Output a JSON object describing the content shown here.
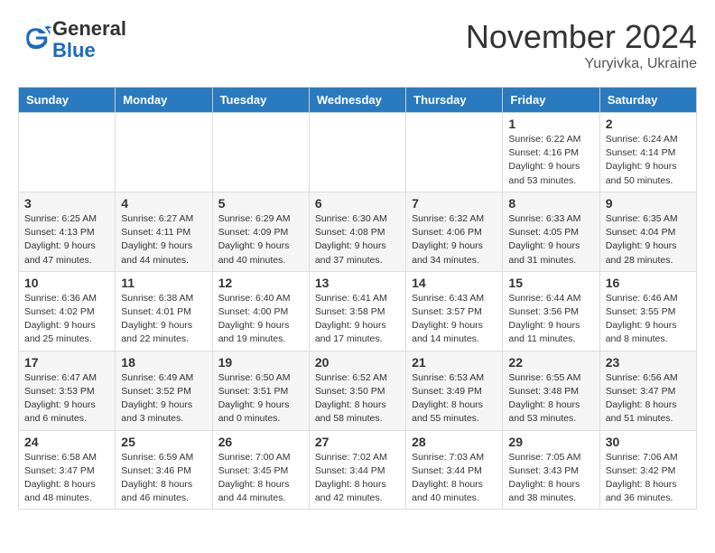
{
  "header": {
    "logo_general": "General",
    "logo_blue": "Blue",
    "month_title": "November 2024",
    "location": "Yuryivka, Ukraine"
  },
  "days_of_week": [
    "Sunday",
    "Monday",
    "Tuesday",
    "Wednesday",
    "Thursday",
    "Friday",
    "Saturday"
  ],
  "weeks": [
    [
      {
        "day": "",
        "info": ""
      },
      {
        "day": "",
        "info": ""
      },
      {
        "day": "",
        "info": ""
      },
      {
        "day": "",
        "info": ""
      },
      {
        "day": "",
        "info": ""
      },
      {
        "day": "1",
        "info": "Sunrise: 6:22 AM\nSunset: 4:16 PM\nDaylight: 9 hours and 53 minutes."
      },
      {
        "day": "2",
        "info": "Sunrise: 6:24 AM\nSunset: 4:14 PM\nDaylight: 9 hours and 50 minutes."
      }
    ],
    [
      {
        "day": "3",
        "info": "Sunrise: 6:25 AM\nSunset: 4:13 PM\nDaylight: 9 hours and 47 minutes."
      },
      {
        "day": "4",
        "info": "Sunrise: 6:27 AM\nSunset: 4:11 PM\nDaylight: 9 hours and 44 minutes."
      },
      {
        "day": "5",
        "info": "Sunrise: 6:29 AM\nSunset: 4:09 PM\nDaylight: 9 hours and 40 minutes."
      },
      {
        "day": "6",
        "info": "Sunrise: 6:30 AM\nSunset: 4:08 PM\nDaylight: 9 hours and 37 minutes."
      },
      {
        "day": "7",
        "info": "Sunrise: 6:32 AM\nSunset: 4:06 PM\nDaylight: 9 hours and 34 minutes."
      },
      {
        "day": "8",
        "info": "Sunrise: 6:33 AM\nSunset: 4:05 PM\nDaylight: 9 hours and 31 minutes."
      },
      {
        "day": "9",
        "info": "Sunrise: 6:35 AM\nSunset: 4:04 PM\nDaylight: 9 hours and 28 minutes."
      }
    ],
    [
      {
        "day": "10",
        "info": "Sunrise: 6:36 AM\nSunset: 4:02 PM\nDaylight: 9 hours and 25 minutes."
      },
      {
        "day": "11",
        "info": "Sunrise: 6:38 AM\nSunset: 4:01 PM\nDaylight: 9 hours and 22 minutes."
      },
      {
        "day": "12",
        "info": "Sunrise: 6:40 AM\nSunset: 4:00 PM\nDaylight: 9 hours and 19 minutes."
      },
      {
        "day": "13",
        "info": "Sunrise: 6:41 AM\nSunset: 3:58 PM\nDaylight: 9 hours and 17 minutes."
      },
      {
        "day": "14",
        "info": "Sunrise: 6:43 AM\nSunset: 3:57 PM\nDaylight: 9 hours and 14 minutes."
      },
      {
        "day": "15",
        "info": "Sunrise: 6:44 AM\nSunset: 3:56 PM\nDaylight: 9 hours and 11 minutes."
      },
      {
        "day": "16",
        "info": "Sunrise: 6:46 AM\nSunset: 3:55 PM\nDaylight: 9 hours and 8 minutes."
      }
    ],
    [
      {
        "day": "17",
        "info": "Sunrise: 6:47 AM\nSunset: 3:53 PM\nDaylight: 9 hours and 6 minutes."
      },
      {
        "day": "18",
        "info": "Sunrise: 6:49 AM\nSunset: 3:52 PM\nDaylight: 9 hours and 3 minutes."
      },
      {
        "day": "19",
        "info": "Sunrise: 6:50 AM\nSunset: 3:51 PM\nDaylight: 9 hours and 0 minutes."
      },
      {
        "day": "20",
        "info": "Sunrise: 6:52 AM\nSunset: 3:50 PM\nDaylight: 8 hours and 58 minutes."
      },
      {
        "day": "21",
        "info": "Sunrise: 6:53 AM\nSunset: 3:49 PM\nDaylight: 8 hours and 55 minutes."
      },
      {
        "day": "22",
        "info": "Sunrise: 6:55 AM\nSunset: 3:48 PM\nDaylight: 8 hours and 53 minutes."
      },
      {
        "day": "23",
        "info": "Sunrise: 6:56 AM\nSunset: 3:47 PM\nDaylight: 8 hours and 51 minutes."
      }
    ],
    [
      {
        "day": "24",
        "info": "Sunrise: 6:58 AM\nSunset: 3:47 PM\nDaylight: 8 hours and 48 minutes."
      },
      {
        "day": "25",
        "info": "Sunrise: 6:59 AM\nSunset: 3:46 PM\nDaylight: 8 hours and 46 minutes."
      },
      {
        "day": "26",
        "info": "Sunrise: 7:00 AM\nSunset: 3:45 PM\nDaylight: 8 hours and 44 minutes."
      },
      {
        "day": "27",
        "info": "Sunrise: 7:02 AM\nSunset: 3:44 PM\nDaylight: 8 hours and 42 minutes."
      },
      {
        "day": "28",
        "info": "Sunrise: 7:03 AM\nSunset: 3:44 PM\nDaylight: 8 hours and 40 minutes."
      },
      {
        "day": "29",
        "info": "Sunrise: 7:05 AM\nSunset: 3:43 PM\nDaylight: 8 hours and 38 minutes."
      },
      {
        "day": "30",
        "info": "Sunrise: 7:06 AM\nSunset: 3:42 PM\nDaylight: 8 hours and 36 minutes."
      }
    ]
  ]
}
